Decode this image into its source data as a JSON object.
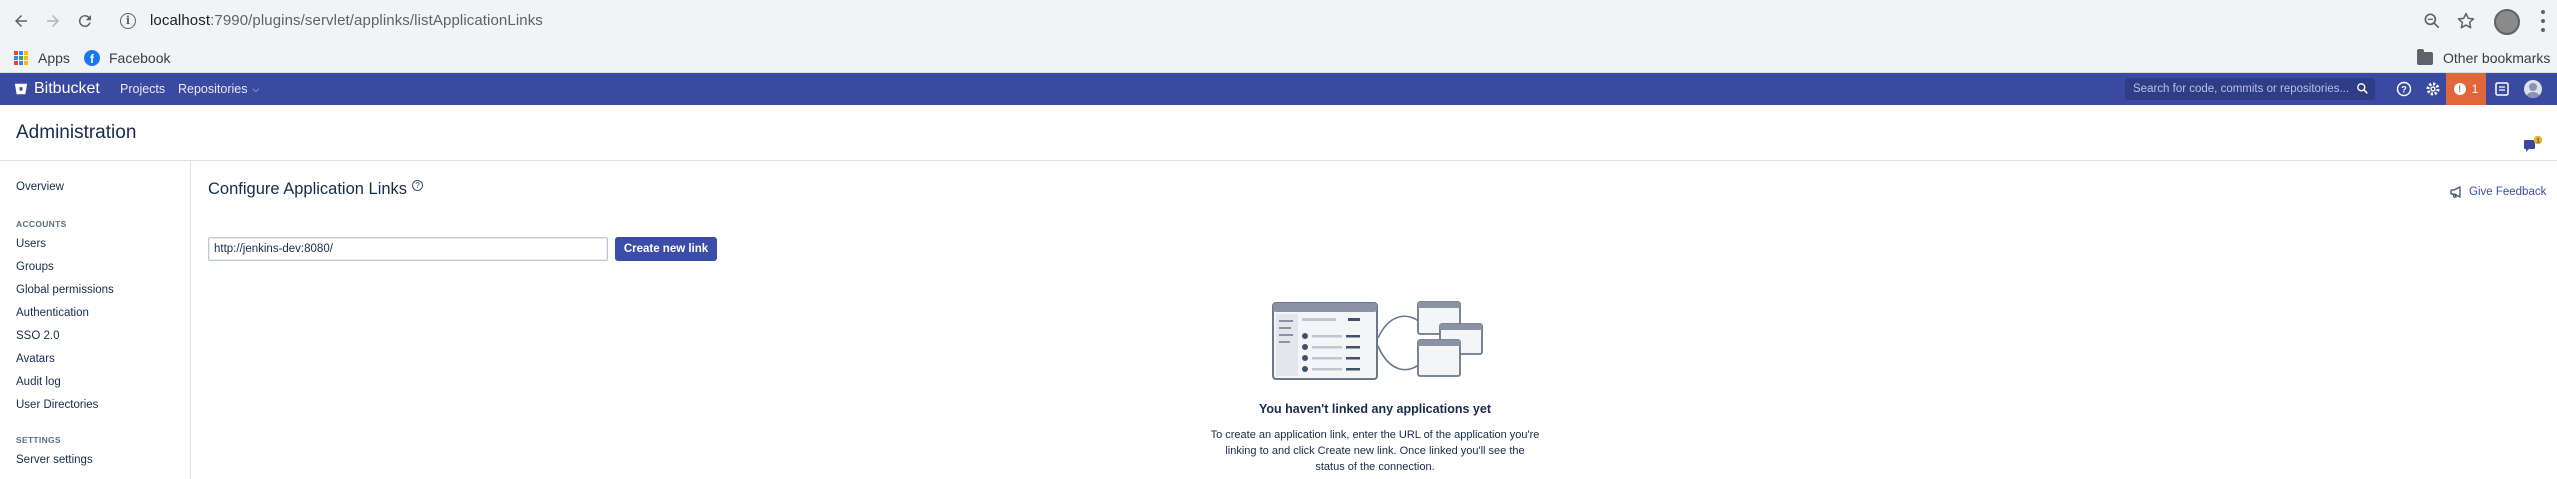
{
  "browser": {
    "url_host": "localhost",
    "url_path": ":7990/plugins/servlet/applinks/listApplicationLinks",
    "bookmarks": [
      {
        "label": "Apps"
      },
      {
        "label": "Facebook"
      }
    ],
    "other_bookmarks": "Other bookmarks"
  },
  "header": {
    "logo": "Bitbucket",
    "nav": [
      "Projects",
      "Repositories"
    ],
    "search_placeholder": "Search for code, commits or repositories...",
    "notification_count": "1",
    "brand_color": "#3a4aa0",
    "notification_color": "#e0663b"
  },
  "page": {
    "title": "Administration"
  },
  "sidebar": {
    "overview": "Overview",
    "accounts_heading": "ACCOUNTS",
    "accounts": [
      "Users",
      "Groups",
      "Global permissions",
      "Authentication",
      "SSO 2.0",
      "Avatars",
      "Audit log",
      "User Directories"
    ],
    "settings_heading": "SETTINGS",
    "settings": [
      "Server settings"
    ]
  },
  "main": {
    "title": "Configure Application Links",
    "help": "?",
    "feedback": "Give Feedback",
    "input_value": "http://jenkins-dev:8080/",
    "create_button": "Create new link",
    "empty_title": "You haven't linked any applications yet",
    "empty_body": "To create an application link, enter the URL of the application you're linking to and click Create new link. Once linked you'll see the status of the connection."
  }
}
